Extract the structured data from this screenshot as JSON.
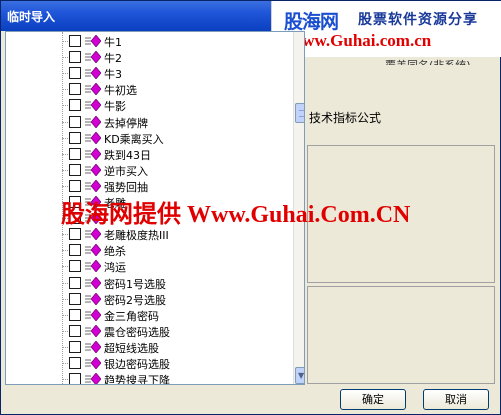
{
  "window": {
    "title": "临时导入"
  },
  "watermark": {
    "logo": "股海网",
    "slogan": "股票软件资源分享",
    "url": "www.Guhai.com.cn",
    "banner": "股海网提供 Www.Guhai.Com.CN"
  },
  "tree": {
    "items": [
      {
        "label": "牛1",
        "checked": false
      },
      {
        "label": "牛2",
        "checked": false
      },
      {
        "label": "牛3",
        "checked": false
      },
      {
        "label": "牛初选",
        "checked": false
      },
      {
        "label": "牛影",
        "checked": false
      },
      {
        "label": "去掉停牌",
        "checked": false
      },
      {
        "label": "KD乘离买入",
        "checked": false
      },
      {
        "label": "跌到43日",
        "checked": false
      },
      {
        "label": "逆市买入",
        "checked": false
      },
      {
        "label": "强势回抽",
        "checked": false
      },
      {
        "label": "老雕",
        "checked": false
      },
      {
        "label": "",
        "checked": false
      },
      {
        "label": "老雕极度热III",
        "checked": false
      },
      {
        "label": "绝杀",
        "checked": false
      },
      {
        "label": "鸿运",
        "checked": false
      },
      {
        "label": "密码1号选股",
        "checked": false
      },
      {
        "label": "密码2号选股",
        "checked": false
      },
      {
        "label": "金三角密码",
        "checked": false
      },
      {
        "label": "震仓密码选股",
        "checked": false
      },
      {
        "label": "超短线选股",
        "checked": false
      },
      {
        "label": "银边密码选股",
        "checked": false
      },
      {
        "label": "趋势搜寻下降",
        "checked": false
      }
    ]
  },
  "right": {
    "radio_text": "覆盖同名(非系统)",
    "formula_label": "技术指标公式"
  },
  "buttons": {
    "ok": "确定",
    "cancel": "取消"
  },
  "colors": {
    "titlebar": "#1f55d8",
    "icon_color": "#d000d0",
    "watermark_red": "#e00000"
  }
}
